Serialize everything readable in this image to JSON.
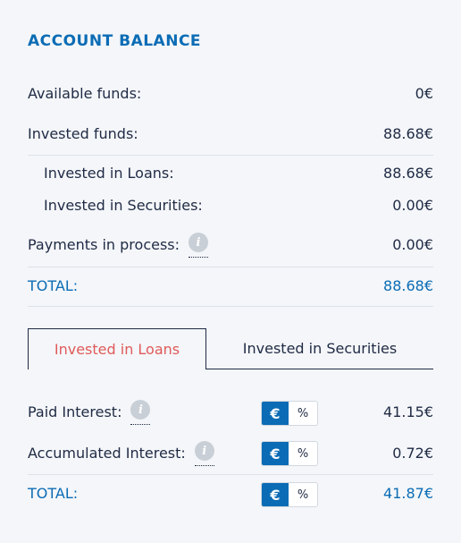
{
  "account_balance": {
    "title": "ACCOUNT BALANCE",
    "available_funds": {
      "label": "Available funds:",
      "value": "0€"
    },
    "invested_funds": {
      "label": "Invested funds:",
      "value": "88.68€"
    },
    "invested_in_loans": {
      "label": "Invested in Loans:",
      "value": "88.68€"
    },
    "invested_in_securities": {
      "label": "Invested in Securities:",
      "value": "0.00€"
    },
    "payments_in_process": {
      "label": "Payments in process:",
      "value": "0.00€"
    },
    "total": {
      "label": "TOTAL:",
      "value": "88.68€"
    }
  },
  "tabs": [
    {
      "label": "Invested in Loans",
      "active": true
    },
    {
      "label": "Invested in Securities",
      "active": false
    }
  ],
  "interest": {
    "toggle": {
      "euro_label": "€",
      "percent_label": "%",
      "selected": "€"
    },
    "paid_interest": {
      "label": "Paid Interest:",
      "value": "41.15€"
    },
    "accumulated_interest": {
      "label": "Accumulated Interest:",
      "value": "0.72€"
    },
    "total": {
      "label": "TOTAL:",
      "value": "41.87€"
    }
  },
  "icons": {
    "info": "info-icon",
    "info_glyph": "i"
  },
  "colors": {
    "accent": "#0b6cb5",
    "active_tab_text": "#e05a5a"
  }
}
